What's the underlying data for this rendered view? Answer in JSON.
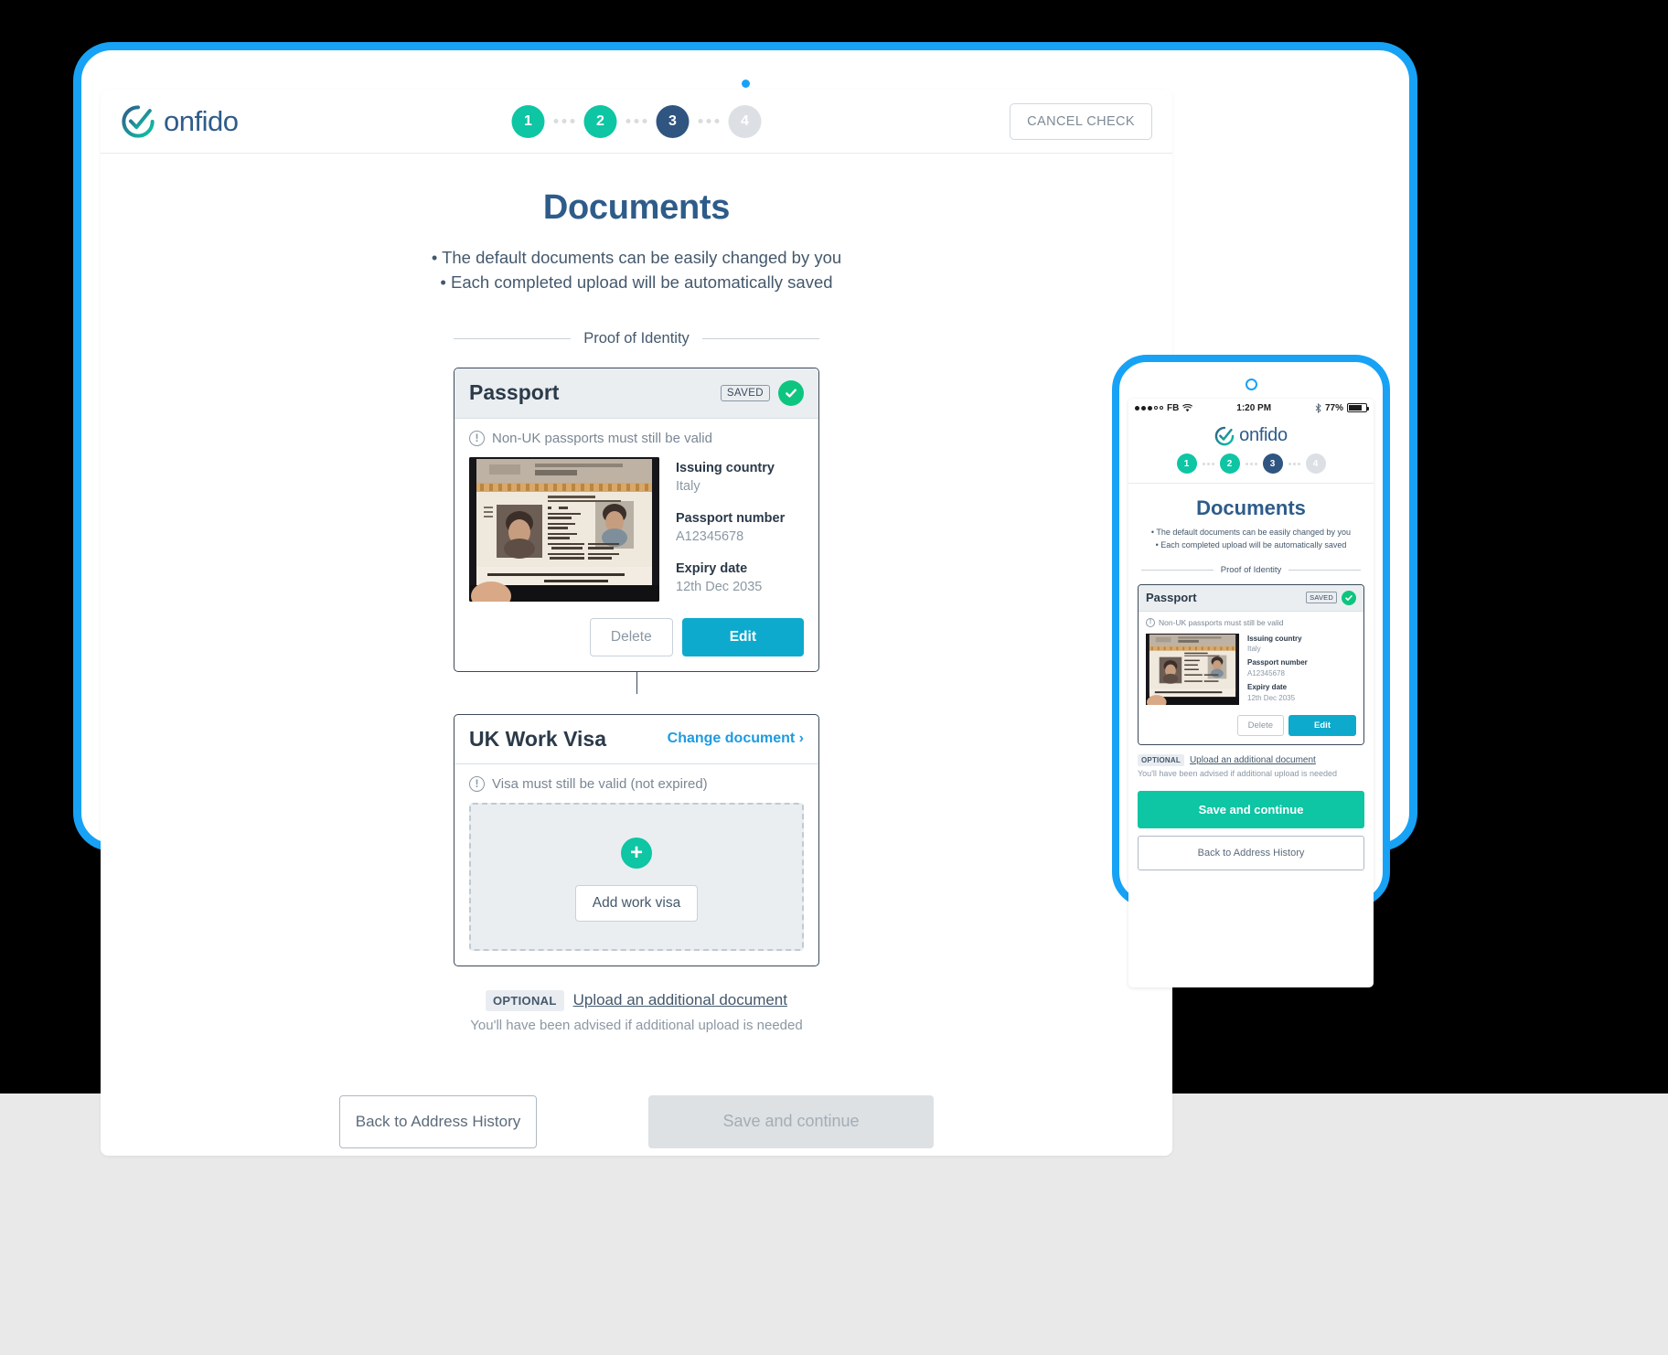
{
  "tablet": {
    "brand": "onfido",
    "stepper": [
      {
        "label": "1",
        "state": "done"
      },
      {
        "label": "2",
        "state": "done"
      },
      {
        "label": "3",
        "state": "current"
      },
      {
        "label": "4",
        "state": "todo"
      }
    ],
    "cancel_check_label": "CANCEL CHECK",
    "page_title": "Documents",
    "bullets": [
      "• The default documents can be easily changed by you",
      "• Each completed upload will be automatically saved"
    ],
    "section_label": "Proof of Identity",
    "passport_card": {
      "title": "Passport",
      "saved_badge": "SAVED",
      "notice": "Non-UK passports must still be valid",
      "fields": [
        {
          "label": "Issuing country",
          "value": "Italy"
        },
        {
          "label": "Passport number",
          "value": "A12345678"
        },
        {
          "label": "Expiry date",
          "value": "12th Dec 2035"
        }
      ],
      "delete_label": "Delete",
      "edit_label": "Edit"
    },
    "visa_card": {
      "title": "UK Work Visa",
      "change_link": "Change document ›",
      "notice": "Visa must still be valid (not expired)",
      "add_button": "Add work visa"
    },
    "optional_badge": "OPTIONAL",
    "optional_link": "Upload an additional document",
    "optional_sub": "You'll have been advised if additional upload is needed",
    "back_label": "Back to Address History",
    "save_label": "Save and continue"
  },
  "phone": {
    "status": {
      "carrier": "FB",
      "time": "1:20 PM",
      "battery_percent": "77%"
    },
    "brand": "onfido",
    "stepper": [
      {
        "label": "1",
        "state": "done"
      },
      {
        "label": "2",
        "state": "done"
      },
      {
        "label": "3",
        "state": "current"
      },
      {
        "label": "4",
        "state": "todo"
      }
    ],
    "page_title": "Documents",
    "bullets": [
      "• The default documents can be easily changed by you",
      "• Each completed upload will be automatically saved"
    ],
    "section_label": "Proof of Identity",
    "passport_card": {
      "title": "Passport",
      "saved_badge": "SAVED",
      "notice": "Non-UK passports must still be valid",
      "fields": [
        {
          "label": "Issuing country",
          "value": "Italy"
        },
        {
          "label": "Passport number",
          "value": "A12345678"
        },
        {
          "label": "Expiry date",
          "value": "12th Dec 2035"
        }
      ],
      "delete_label": "Delete",
      "edit_label": "Edit"
    },
    "optional_badge": "OPTIONAL",
    "optional_link": "Upload an additional document",
    "optional_sub": "You'll have been advised if additional upload is needed",
    "save_label": "Save and continue",
    "back_label": "Back to Address History"
  },
  "colors": {
    "accent_teal": "#0ec5a4",
    "accent_blue": "#2e5c8a",
    "device_blue": "#17a2f5",
    "edit_cyan": "#0eaacd",
    "link_blue": "#1e9be0",
    "muted": "#8b98a4"
  }
}
